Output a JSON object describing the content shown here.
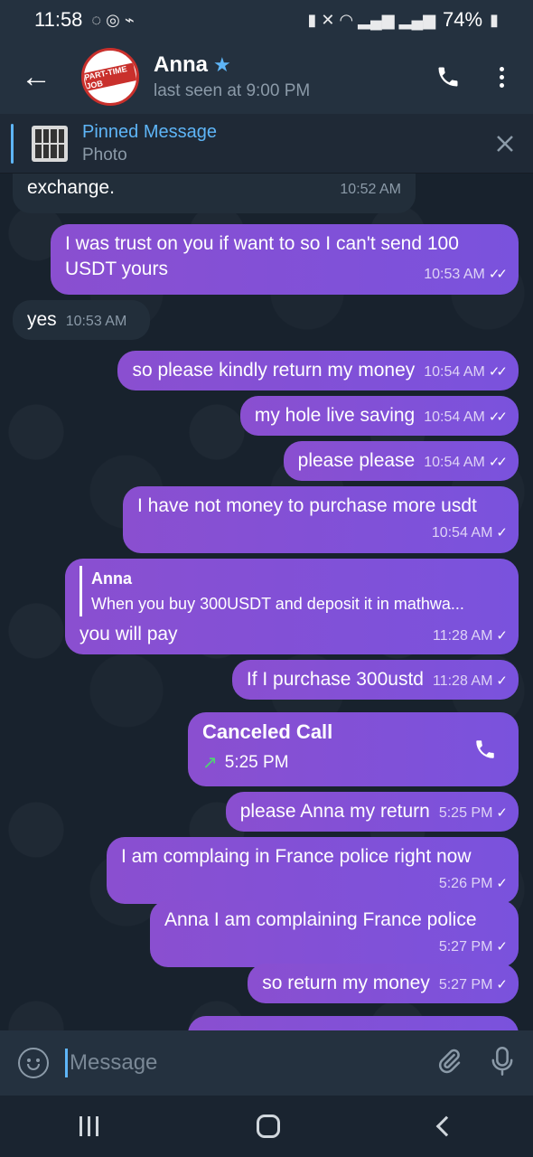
{
  "status_bar": {
    "time": "11:58",
    "battery": "74%"
  },
  "header": {
    "avatar_text": "PART-TIME JOB",
    "name": "Anna",
    "star": "★",
    "status": "last seen at 9:00 PM",
    "back_label": "←"
  },
  "pinned": {
    "title": "Pinned Message",
    "subtitle": "Photo"
  },
  "messages": [
    {
      "dir": "in",
      "text_partial": "exchange.",
      "time": "10:52 AM"
    },
    {
      "dir": "out",
      "text": "I was trust on you if want to so I can't send 100 USDT yours",
      "time": "10:53 AM",
      "ticks": "✓✓"
    },
    {
      "dir": "in",
      "text": "yes",
      "time": "10:53 AM"
    },
    {
      "dir": "out",
      "text": "so please kindly return my money",
      "time": "10:54 AM",
      "ticks": "✓✓"
    },
    {
      "dir": "out",
      "text": "my hole live saving",
      "time": "10:54 AM",
      "ticks": "✓✓"
    },
    {
      "dir": "out",
      "text": "please please",
      "time": "10:54 AM",
      "ticks": "✓✓"
    },
    {
      "dir": "out",
      "text": "I have not money to purchase more usdt",
      "time": "10:54 AM",
      "ticks": "✓"
    },
    {
      "dir": "out",
      "reply_name": "Anna",
      "reply_text": "When you buy 300USDT and deposit it in mathwa...",
      "text": "you will pay",
      "time": "11:28 AM",
      "ticks": "✓"
    },
    {
      "dir": "out",
      "text": "If I purchase 300ustd",
      "time": "11:28 AM",
      "ticks": "✓"
    },
    {
      "dir": "out",
      "call_title": "Canceled Call",
      "call_time": "5:25 PM",
      "call_arrow": "↗"
    },
    {
      "dir": "out",
      "text": "please Anna my return",
      "time": "5:25 PM",
      "ticks": "✓"
    },
    {
      "dir": "out",
      "text": "I am complaing in France police right now",
      "time": "5:26 PM",
      "ticks": "✓"
    },
    {
      "dir": "out",
      "text": "Anna I am complaining France police",
      "time": "5:27 PM",
      "ticks": "✓"
    },
    {
      "dir": "out",
      "text": "so return my money",
      "time": "5:27 PM",
      "ticks": "✓"
    }
  ],
  "composer": {
    "placeholder": "Message"
  }
}
